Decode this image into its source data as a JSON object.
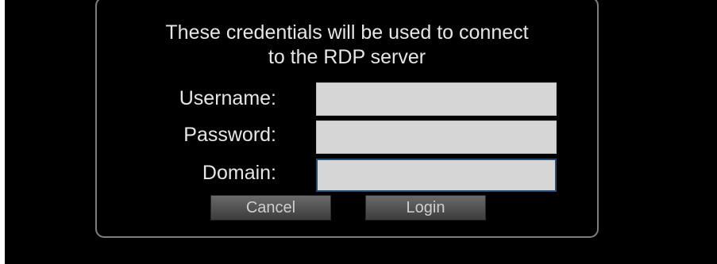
{
  "dialog": {
    "message_line1": "These credentials will be used to connect",
    "message_line2": "to the RDP server",
    "fields": {
      "username_label": "Username:",
      "username_value": "",
      "password_label": "Password:",
      "password_value": "",
      "domain_label": "Domain:",
      "domain_value": ""
    },
    "buttons": {
      "cancel_label": "Cancel",
      "login_label": "Login"
    }
  },
  "colors": {
    "background": "#000000",
    "dialog_border": "#7f7f7f",
    "text": "#e6e6e6",
    "field_bg": "#d6d6d6",
    "focus_border": "#2b4a6b"
  }
}
